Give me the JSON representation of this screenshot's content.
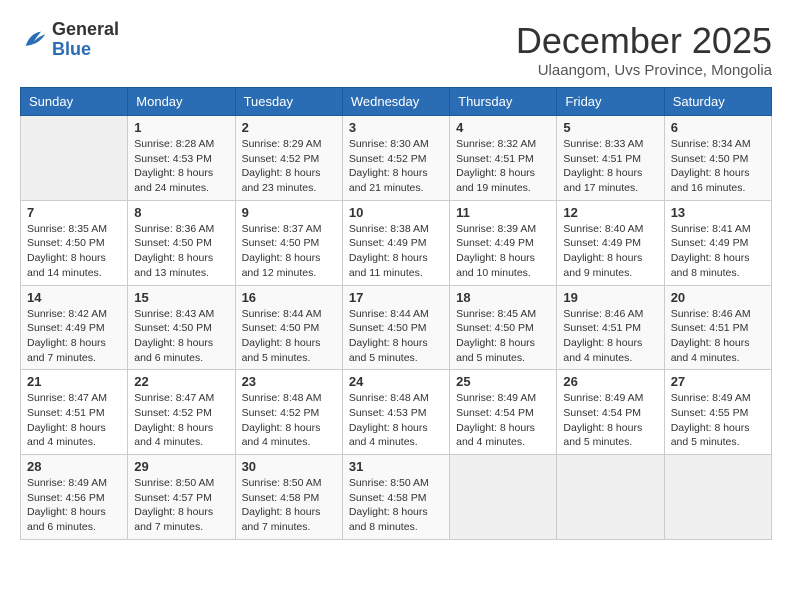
{
  "logo": {
    "general": "General",
    "blue": "Blue"
  },
  "header": {
    "month": "December 2025",
    "location": "Ulaangom, Uvs Province, Mongolia"
  },
  "days_of_week": [
    "Sunday",
    "Monday",
    "Tuesday",
    "Wednesday",
    "Thursday",
    "Friday",
    "Saturday"
  ],
  "weeks": [
    [
      {
        "day": "",
        "sunrise": "",
        "sunset": "",
        "daylight": ""
      },
      {
        "day": "1",
        "sunrise": "8:28 AM",
        "sunset": "4:53 PM",
        "daylight": "8 hours and 24 minutes."
      },
      {
        "day": "2",
        "sunrise": "8:29 AM",
        "sunset": "4:52 PM",
        "daylight": "8 hours and 23 minutes."
      },
      {
        "day": "3",
        "sunrise": "8:30 AM",
        "sunset": "4:52 PM",
        "daylight": "8 hours and 21 minutes."
      },
      {
        "day": "4",
        "sunrise": "8:32 AM",
        "sunset": "4:51 PM",
        "daylight": "8 hours and 19 minutes."
      },
      {
        "day": "5",
        "sunrise": "8:33 AM",
        "sunset": "4:51 PM",
        "daylight": "8 hours and 17 minutes."
      },
      {
        "day": "6",
        "sunrise": "8:34 AM",
        "sunset": "4:50 PM",
        "daylight": "8 hours and 16 minutes."
      }
    ],
    [
      {
        "day": "7",
        "sunrise": "8:35 AM",
        "sunset": "4:50 PM",
        "daylight": "8 hours and 14 minutes."
      },
      {
        "day": "8",
        "sunrise": "8:36 AM",
        "sunset": "4:50 PM",
        "daylight": "8 hours and 13 minutes."
      },
      {
        "day": "9",
        "sunrise": "8:37 AM",
        "sunset": "4:50 PM",
        "daylight": "8 hours and 12 minutes."
      },
      {
        "day": "10",
        "sunrise": "8:38 AM",
        "sunset": "4:49 PM",
        "daylight": "8 hours and 11 minutes."
      },
      {
        "day": "11",
        "sunrise": "8:39 AM",
        "sunset": "4:49 PM",
        "daylight": "8 hours and 10 minutes."
      },
      {
        "day": "12",
        "sunrise": "8:40 AM",
        "sunset": "4:49 PM",
        "daylight": "8 hours and 9 minutes."
      },
      {
        "day": "13",
        "sunrise": "8:41 AM",
        "sunset": "4:49 PM",
        "daylight": "8 hours and 8 minutes."
      }
    ],
    [
      {
        "day": "14",
        "sunrise": "8:42 AM",
        "sunset": "4:49 PM",
        "daylight": "8 hours and 7 minutes."
      },
      {
        "day": "15",
        "sunrise": "8:43 AM",
        "sunset": "4:50 PM",
        "daylight": "8 hours and 6 minutes."
      },
      {
        "day": "16",
        "sunrise": "8:44 AM",
        "sunset": "4:50 PM",
        "daylight": "8 hours and 5 minutes."
      },
      {
        "day": "17",
        "sunrise": "8:44 AM",
        "sunset": "4:50 PM",
        "daylight": "8 hours and 5 minutes."
      },
      {
        "day": "18",
        "sunrise": "8:45 AM",
        "sunset": "4:50 PM",
        "daylight": "8 hours and 5 minutes."
      },
      {
        "day": "19",
        "sunrise": "8:46 AM",
        "sunset": "4:51 PM",
        "daylight": "8 hours and 4 minutes."
      },
      {
        "day": "20",
        "sunrise": "8:46 AM",
        "sunset": "4:51 PM",
        "daylight": "8 hours and 4 minutes."
      }
    ],
    [
      {
        "day": "21",
        "sunrise": "8:47 AM",
        "sunset": "4:51 PM",
        "daylight": "8 hours and 4 minutes."
      },
      {
        "day": "22",
        "sunrise": "8:47 AM",
        "sunset": "4:52 PM",
        "daylight": "8 hours and 4 minutes."
      },
      {
        "day": "23",
        "sunrise": "8:48 AM",
        "sunset": "4:52 PM",
        "daylight": "8 hours and 4 minutes."
      },
      {
        "day": "24",
        "sunrise": "8:48 AM",
        "sunset": "4:53 PM",
        "daylight": "8 hours and 4 minutes."
      },
      {
        "day": "25",
        "sunrise": "8:49 AM",
        "sunset": "4:54 PM",
        "daylight": "8 hours and 4 minutes."
      },
      {
        "day": "26",
        "sunrise": "8:49 AM",
        "sunset": "4:54 PM",
        "daylight": "8 hours and 5 minutes."
      },
      {
        "day": "27",
        "sunrise": "8:49 AM",
        "sunset": "4:55 PM",
        "daylight": "8 hours and 5 minutes."
      }
    ],
    [
      {
        "day": "28",
        "sunrise": "8:49 AM",
        "sunset": "4:56 PM",
        "daylight": "8 hours and 6 minutes."
      },
      {
        "day": "29",
        "sunrise": "8:50 AM",
        "sunset": "4:57 PM",
        "daylight": "8 hours and 7 minutes."
      },
      {
        "day": "30",
        "sunrise": "8:50 AM",
        "sunset": "4:58 PM",
        "daylight": "8 hours and 7 minutes."
      },
      {
        "day": "31",
        "sunrise": "8:50 AM",
        "sunset": "4:58 PM",
        "daylight": "8 hours and 8 minutes."
      },
      {
        "day": "",
        "sunrise": "",
        "sunset": "",
        "daylight": ""
      },
      {
        "day": "",
        "sunrise": "",
        "sunset": "",
        "daylight": ""
      },
      {
        "day": "",
        "sunrise": "",
        "sunset": "",
        "daylight": ""
      }
    ]
  ],
  "labels": {
    "sunrise_prefix": "Sunrise: ",
    "sunset_prefix": "Sunset: ",
    "daylight_prefix": "Daylight: "
  }
}
